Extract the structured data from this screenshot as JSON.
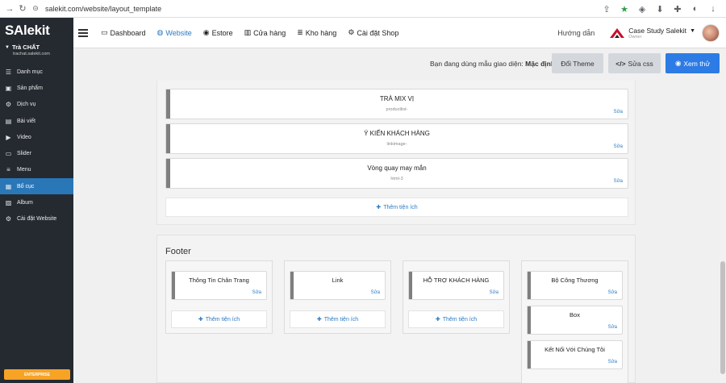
{
  "browser": {
    "url": "salekit.com/website/layout_template"
  },
  "sidebar": {
    "logo": "SAlekit",
    "site_name": "Trà CHẤT",
    "site_url": "trachat.salekit.com",
    "items": [
      {
        "label": "Danh mục",
        "icon": "list-icon"
      },
      {
        "label": "Sản phẩm",
        "icon": "box-icon"
      },
      {
        "label": "Dịch vụ",
        "icon": "gear-icon"
      },
      {
        "label": "Bài viết",
        "icon": "document-icon"
      },
      {
        "label": "Video",
        "icon": "video-icon"
      },
      {
        "label": "Slider",
        "icon": "slider-icon"
      },
      {
        "label": "Menu",
        "icon": "menu-icon"
      },
      {
        "label": "Bố cục",
        "icon": "layout-icon",
        "active": true
      },
      {
        "label": "Album",
        "icon": "image-icon"
      },
      {
        "label": "Cài đặt Website",
        "icon": "settings-icon"
      }
    ],
    "enterprise_label": "ENTERPRISE"
  },
  "topnav": {
    "items": [
      {
        "label": "Dashboard",
        "icon": "monitor-icon"
      },
      {
        "label": "Website",
        "icon": "globe-icon",
        "active": true
      },
      {
        "label": "Estore",
        "icon": "compass-icon"
      },
      {
        "label": "Cửa hàng",
        "icon": "store-icon"
      },
      {
        "label": "Kho hàng",
        "icon": "database-icon"
      },
      {
        "label": "Cài đặt Shop",
        "icon": "gear-icon"
      }
    ],
    "help": "Hướng dẫn",
    "user_name": "Case Study Salekit",
    "user_role": "Owner"
  },
  "toolbar": {
    "theme_prefix": "Bạn đang dùng mẫu giao diện:",
    "theme_name": "Mặc định",
    "change_theme": "Đổi Theme",
    "edit_css": "Sửa css",
    "preview": "Xem thử"
  },
  "main_widgets": [
    {
      "title": "TRÀ MIX VỊ",
      "subtitle": "productlist-",
      "edit": "Sửa"
    },
    {
      "title": "Ý KIẾN KHÁCH HÀNG",
      "subtitle": "linkimage-",
      "edit": "Sửa"
    },
    {
      "title": "Vòng quay may mắn",
      "subtitle": "html-3",
      "edit": "Sửa"
    }
  ],
  "add_widget_label": "Thêm tiện ích",
  "footer": {
    "title": "Footer",
    "columns": [
      {
        "widgets": [
          {
            "title": "Thông Tin Chân Trang",
            "edit": "Sửa"
          }
        ],
        "add": "Thêm tiện ích"
      },
      {
        "widgets": [
          {
            "title": "Link",
            "edit": "Sửa"
          }
        ],
        "add": "Thêm tiện ích"
      },
      {
        "widgets": [
          {
            "title": "HỖ TRỢ KHÁCH HÀNG",
            "edit": "Sửa"
          }
        ],
        "add": "Thêm tiện ích"
      },
      {
        "widgets": [
          {
            "title": "Bộ Công Thương",
            "edit": "Sửa"
          },
          {
            "title": "Box",
            "edit": "Sửa"
          },
          {
            "title": "Kết Nối Với Chúng Tôi",
            "edit": "Sửa"
          }
        ]
      }
    ]
  },
  "colors": {
    "sidebar_bg": "#252a31",
    "active_blue": "#2a77b8",
    "link_blue": "#2a7ac2",
    "preview_button": "#2d7be5",
    "enterprise": "#f7a325"
  }
}
